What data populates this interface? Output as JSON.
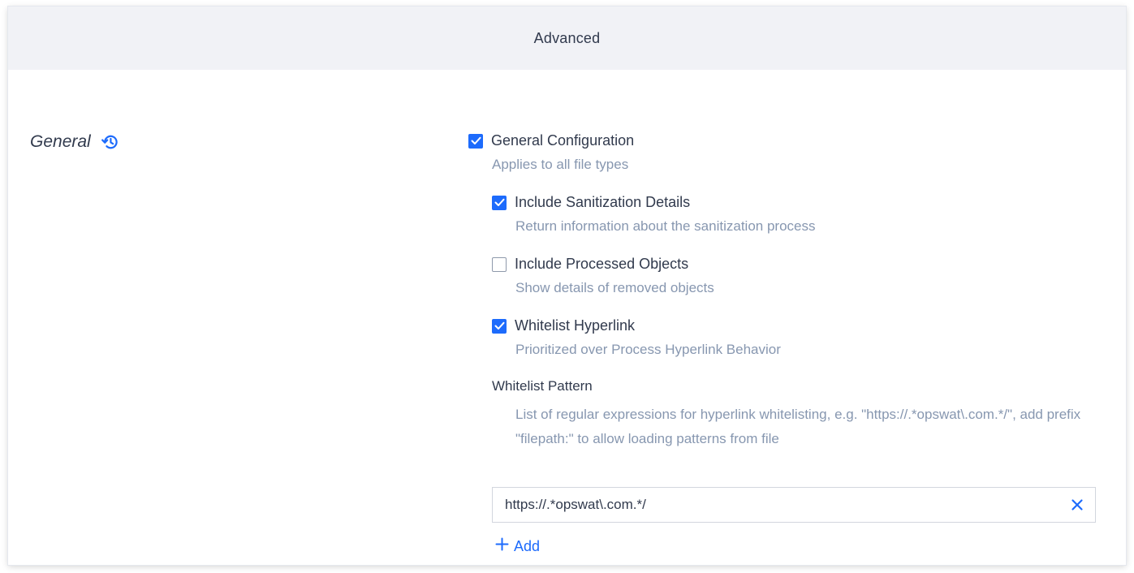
{
  "header": {
    "title": "Advanced"
  },
  "section": {
    "title": "General",
    "icon": "history-icon"
  },
  "options": [
    {
      "label": "General Configuration",
      "description": "Applies to all file types",
      "checked": true
    },
    {
      "label": "Include Sanitization Details",
      "description": "Return information about the sanitization process",
      "checked": true
    },
    {
      "label": "Include Processed Objects",
      "description": "Show details of removed objects",
      "checked": false
    },
    {
      "label": "Whitelist Hyperlink",
      "description": "Prioritized over Process Hyperlink Behavior",
      "checked": true
    }
  ],
  "whitelist_pattern": {
    "title": "Whitelist Pattern",
    "description": "List of regular expressions for hyperlink whitelisting, e.g. \"https://.*opswat\\.com.*/\", add prefix \"filepath:\" to allow loading patterns from file",
    "value": "https://.*opswat\\.com.*/",
    "add_label": "Add"
  },
  "colors": {
    "accent": "#1d6bfc",
    "text_primary": "#313a4d",
    "text_secondary": "#8797b0",
    "header_bg": "#f1f2f6"
  }
}
